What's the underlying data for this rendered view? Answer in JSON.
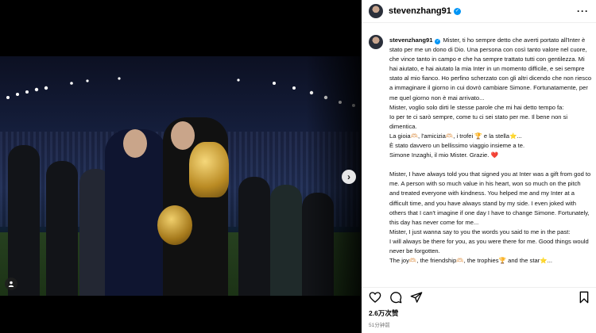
{
  "post": {
    "username": "stevenzhang91",
    "verified": true
  },
  "caption_lines": [
    "Mister, ti ho sempre detto che averti portato all'Inter è stato per me un dono di Dio. Una persona con così tanto valore nel cuore, che vince tanto in campo e che ha sempre trattato tutti con gentilezza. Mi hai aiutato, e hai aiutato la mia Inter in un momento difficile, e sei sempre stato al mio fianco. Ho perfino scherzato con gli altri dicendo che non riesco a immaginare il giorno in cui dovrò cambiare Simone. Fortunatamente, per me quel giorno non è mai arrivato...",
    "Mister, voglio solo dirti le stesse parole che mi hai detto tempo fa:",
    "Io per te ci sarò sempre, come tu ci sei stato per me. Il bene non si dimentica.",
    "La gioia🫶🏻, l'amicizia🫶🏻, i trofei 🏆 e la stella⭐...",
    "È stato davvero un bellissimo viaggio insieme a te.",
    "Simone Inzaghi, il mio Mister. Grazie. ❤️",
    "",
    "Mister, I have always told you that signed you at Inter was a gift from god to me. A person with so much value in his heart, won so much on the pitch and treated everyone with kindness. You helped me and my Inter at a difficult time, and you have always stand by my side. I even joked with others that I can't imagine if one day I have to change Simone. Fortunately, this day has never come for me...",
    "Mister, I just wanna say to you the words you said to me in the past:",
    "I will always be there for you, as you were there for me. Good things would never be forgotten.",
    "The joy🫶🏻, the friendship🫶🏻, the trophies🏆 and the star⭐..."
  ],
  "likes": "2.6万次赞",
  "time_ago": "51分钟前",
  "icons": {
    "header_more": "more-options-icon",
    "like": "heart-icon",
    "comment": "comment-icon",
    "share": "share-icon",
    "save": "bookmark-icon",
    "next": "chevron-right-icon",
    "tagged": "tagged-user-icon"
  },
  "colors": {
    "verified": "#0095f6",
    "panel_bg": "#ffffff",
    "media_bg": "#000000"
  }
}
